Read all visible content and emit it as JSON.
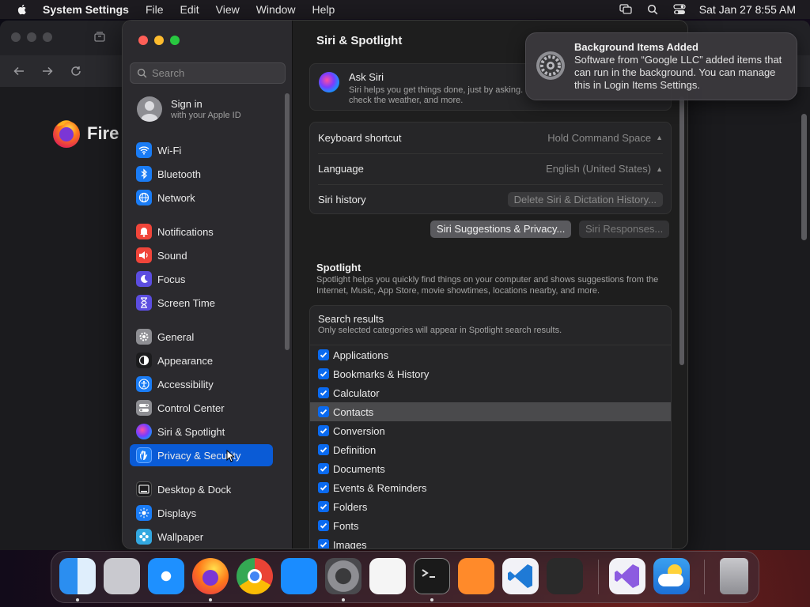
{
  "menubar": {
    "app_name": "System Settings",
    "menus": [
      "File",
      "Edit",
      "View",
      "Window",
      "Help"
    ],
    "clock": "Sat Jan 27  8:55 AM"
  },
  "browser": {
    "brand_partial": "Fire"
  },
  "sidebar": {
    "search_placeholder": "Search",
    "account": {
      "title": "Sign in",
      "subtitle": "with your Apple ID"
    },
    "items": [
      {
        "label": "Wi-Fi",
        "icon": "wifi-icon",
        "color": "#1a7cf5"
      },
      {
        "label": "Bluetooth",
        "icon": "bluetooth-icon",
        "color": "#1a7cf5"
      },
      {
        "label": "Network",
        "icon": "globe-icon",
        "color": "#1a7cf5"
      },
      {
        "label": "Notifications",
        "icon": "bell-icon",
        "color": "#f0453a"
      },
      {
        "label": "Sound",
        "icon": "speaker-icon",
        "color": "#f0453a"
      },
      {
        "label": "Focus",
        "icon": "moon-icon",
        "color": "#5c4de0"
      },
      {
        "label": "Screen Time",
        "icon": "hourglass-icon",
        "color": "#5c4de0"
      },
      {
        "label": "General",
        "icon": "gear-icon",
        "color": "#8e8e93"
      },
      {
        "label": "Appearance",
        "icon": "appearance-icon",
        "color": "#1c1c1e"
      },
      {
        "label": "Accessibility",
        "icon": "accessibility-icon",
        "color": "#1a7cf5"
      },
      {
        "label": "Control Center",
        "icon": "toggles-icon",
        "color": "#8e8e93"
      },
      {
        "label": "Siri & Spotlight",
        "icon": "siri-icon",
        "color": "#2b2b2e"
      },
      {
        "label": "Privacy & Security",
        "icon": "hand-icon",
        "color": "#1a7cf5"
      },
      {
        "label": "Desktop & Dock",
        "icon": "dock-icon",
        "color": "#1c1c1e"
      },
      {
        "label": "Displays",
        "icon": "sun-icon",
        "color": "#1a7cf5"
      },
      {
        "label": "Wallpaper",
        "icon": "wallpaper-icon",
        "color": "#33a8e0"
      }
    ],
    "active_index": 12
  },
  "content": {
    "title": "Siri & Spotlight",
    "ask_siri": {
      "title": "Ask Siri",
      "desc_line1": "Siri helps you get things done, just by asking.",
      "desc_line2": "check the weather, and more."
    },
    "keyboard_shortcut": {
      "label": "Keyboard shortcut",
      "value": "Hold Command Space"
    },
    "language": {
      "label": "Language",
      "value": "English (United States)"
    },
    "siri_history": {
      "label": "Siri history",
      "button": "Delete Siri & Dictation History..."
    },
    "buttons": {
      "suggestions": "Siri Suggestions & Privacy...",
      "responses": "Siri Responses..."
    },
    "spotlight": {
      "title": "Spotlight",
      "desc": "Spotlight helps you quickly find things on your computer and shows suggestions from the Internet, Music, App Store, movie showtimes, locations nearby, and more."
    },
    "results": {
      "title": "Search results",
      "subtitle": "Only selected categories will appear in Spotlight search results.",
      "items": [
        "Applications",
        "Bookmarks & History",
        "Calculator",
        "Contacts",
        "Conversion",
        "Definition",
        "Documents",
        "Events & Reminders",
        "Folders",
        "Fonts",
        "Images"
      ],
      "selected_index": 3
    }
  },
  "notification": {
    "title": "Background Items Added",
    "body": "Software from “Google LLC” added items that can run in the background. You can manage this in Login Items Settings."
  },
  "dock": {
    "apps": [
      {
        "name": "finder-icon",
        "color": "#2b8ef0",
        "running": true
      },
      {
        "name": "launchpad-icon",
        "color": "#c9c9cf",
        "running": false
      },
      {
        "name": "safari-icon",
        "color": "#1e90ff",
        "running": false
      },
      {
        "name": "firefox-icon",
        "color": "#ff7a1a",
        "running": true
      },
      {
        "name": "chrome-icon",
        "color": "#f2f2f2",
        "running": false
      },
      {
        "name": "app-store-icon",
        "color": "#1a8cff",
        "running": false
      },
      {
        "name": "system-settings-icon",
        "color": "#8e8e93",
        "running": true
      },
      {
        "name": "textedit-icon",
        "color": "#f5f5f5",
        "running": false
      },
      {
        "name": "terminal-icon",
        "color": "#1a1a1a",
        "running": true
      },
      {
        "name": "garageband-icon",
        "color": "#ff8a2a",
        "running": false
      },
      {
        "name": "vscode-icon",
        "color": "#1f7ad6",
        "running": false
      },
      {
        "name": "alfred-icon",
        "color": "#2a2a2a",
        "running": false
      },
      {
        "name": "visual-studio-icon",
        "color": "#f2f2f7",
        "running": false
      },
      {
        "name": "weather-icon",
        "color": "#3aa0f0",
        "running": false
      },
      {
        "name": "trash-icon",
        "color": "#a0a0a5",
        "running": false
      }
    ]
  },
  "colors": {
    "accent": "#0a5bd6",
    "checkbox": "#0a6af0",
    "close": "#ff5f57",
    "minimize": "#febc2e",
    "zoom": "#28c840"
  }
}
